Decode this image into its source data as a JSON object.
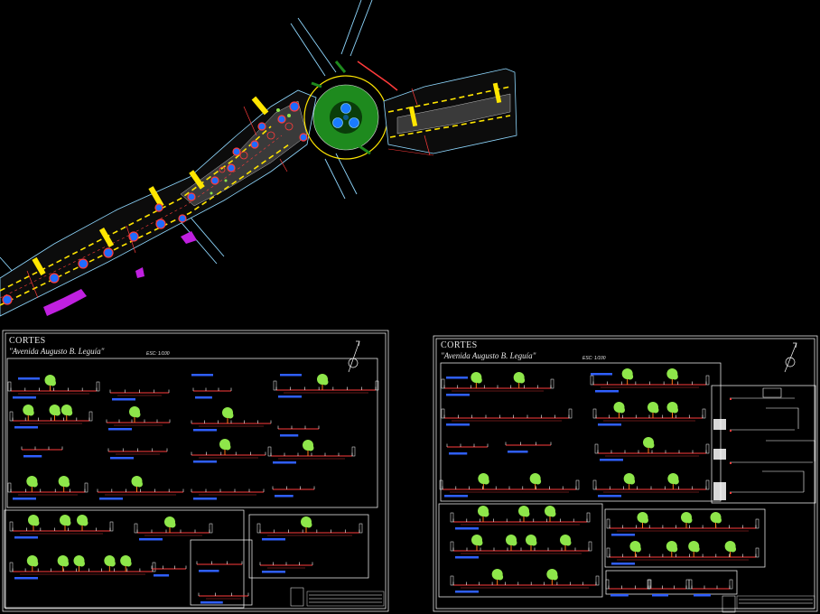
{
  "sheets": [
    {
      "title": "CORTES",
      "subtitle": "\"Avenida Augusto B. Leguía\"",
      "scale": "ESC: 1/100"
    },
    {
      "title": "CORTES",
      "subtitle": "\"Avenida Augusto B. Leguía\"",
      "scale": "ESC: 1/100"
    }
  ],
  "colors": {
    "background": "#000000",
    "frame": "#ffffff",
    "road_edge": "#ff3b3b",
    "curb": "#ffffff",
    "tree_foliage": "#8ee64a",
    "trunk": "#ff7a1a",
    "label_bar": "#2f5fff",
    "median_yellow": "#ffe600",
    "street_blue": "#1f6bff",
    "magenta": "#c020e0",
    "grass": "#1e8a1e",
    "fountain_blue": "#1a7bff",
    "map_outline": "#8fd8ff"
  }
}
